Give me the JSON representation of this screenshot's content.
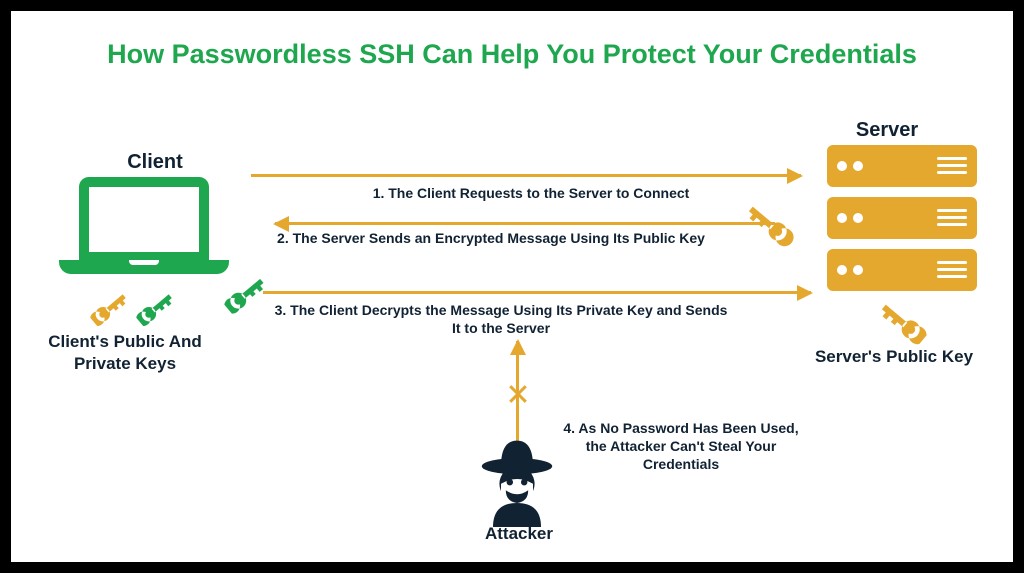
{
  "title": "How Passwordless SSH Can Help You Protect Your Credentials",
  "client": {
    "label": "Client",
    "keys_label": "Client's Public And Private Keys"
  },
  "server": {
    "label": "Server",
    "key_label": "Server's Public Key"
  },
  "attacker": {
    "label": "Attacker"
  },
  "steps": {
    "s1": "1. The Client Requests to the Server to Connect",
    "s2": "2. The Server Sends an Encrypted Message Using Its Public Key",
    "s3": "3. The Client Decrypts the Message Using Its Private Key and Sends It to the Server",
    "s4": "4. As No Password Has Been Used, the Attacker Can't Steal Your Credentials"
  },
  "chart_data": {
    "type": "flow-diagram",
    "nodes": [
      {
        "id": "client",
        "label": "Client",
        "has": [
          "public-key",
          "private-key"
        ]
      },
      {
        "id": "server",
        "label": "Server",
        "has": [
          "public-key"
        ]
      },
      {
        "id": "attacker",
        "label": "Attacker"
      }
    ],
    "edges": [
      {
        "from": "client",
        "to": "server",
        "label": "1. The Client Requests to the Server to Connect"
      },
      {
        "from": "server",
        "to": "client",
        "label": "2. The Server Sends an Encrypted Message Using Its Public Key",
        "key": "server-public"
      },
      {
        "from": "client",
        "to": "server",
        "label": "3. The Client Decrypts the Message Using Its Private Key and Sends It to the Server",
        "key": "client-private"
      },
      {
        "from": "attacker",
        "to": "channel",
        "blocked": true,
        "label": "4. As No Password Has Been Used, the Attacker Can't Steal Your Credentials"
      }
    ]
  }
}
